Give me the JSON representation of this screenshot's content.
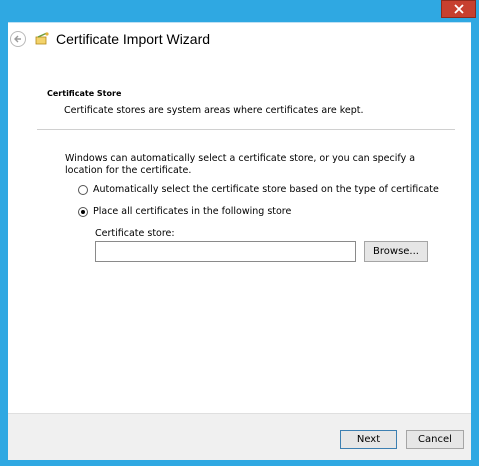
{
  "window": {
    "title": "Certificate Import Wizard",
    "close_glyph": "✕",
    "accent_color": "#2fa8e2",
    "close_color": "#c7402f"
  },
  "header": {
    "back_icon": "back-arrow-icon",
    "wizard_icon": "certificate-wizard-icon"
  },
  "section": {
    "title": "Certificate Store",
    "description": "Certificate stores are system areas where certificates are kept."
  },
  "body": {
    "intro": "Windows can automatically select a certificate store, or you can specify a location for the certificate.",
    "options": [
      {
        "label": "Automatically select the certificate store based on the type of certificate",
        "selected": false
      },
      {
        "label": "Place all certificates in the following store",
        "selected": true
      }
    ],
    "store_label": "Certificate store:",
    "store_value": "",
    "browse_label": "Browse..."
  },
  "footer": {
    "next_label": "Next",
    "cancel_label": "Cancel"
  }
}
